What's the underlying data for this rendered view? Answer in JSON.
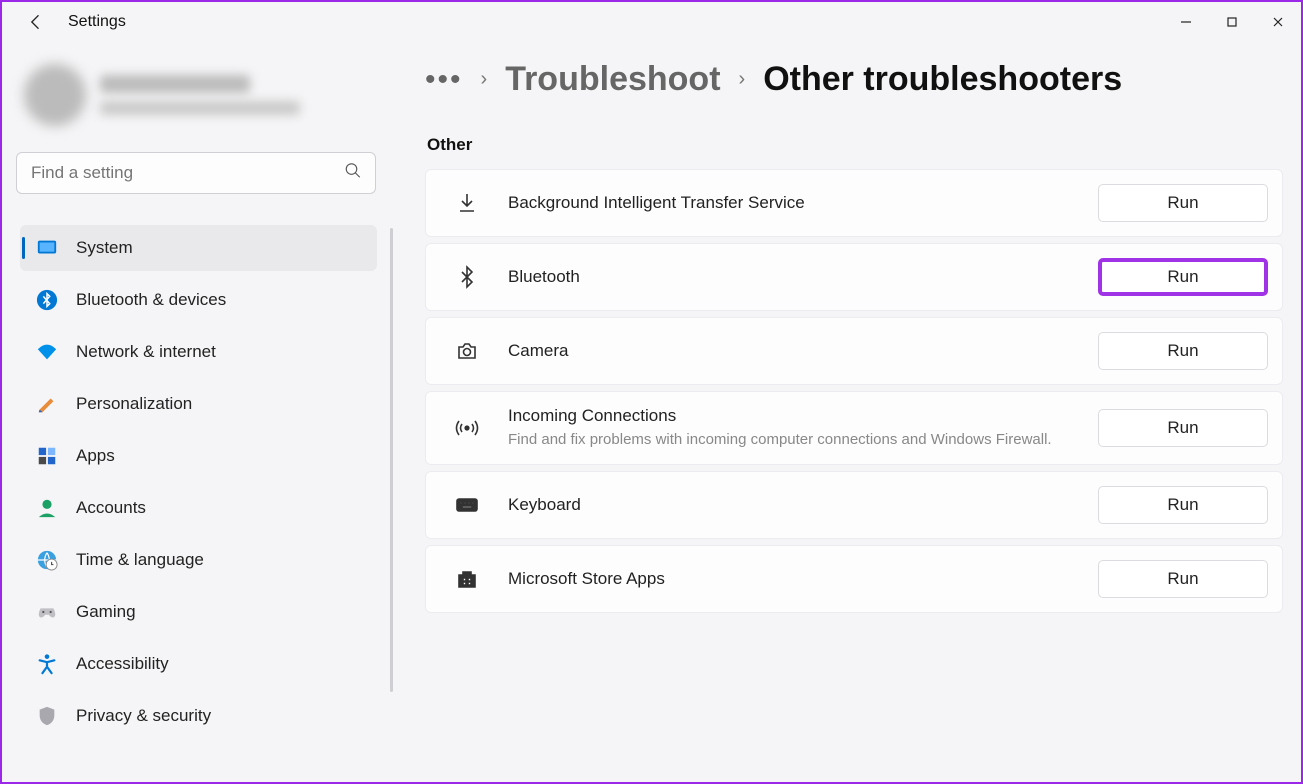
{
  "app": {
    "title": "Settings"
  },
  "search": {
    "placeholder": "Find a setting"
  },
  "sidebar": {
    "items": [
      {
        "label": "System"
      },
      {
        "label": "Bluetooth & devices"
      },
      {
        "label": "Network & internet"
      },
      {
        "label": "Personalization"
      },
      {
        "label": "Apps"
      },
      {
        "label": "Accounts"
      },
      {
        "label": "Time & language"
      },
      {
        "label": "Gaming"
      },
      {
        "label": "Accessibility"
      },
      {
        "label": "Privacy & security"
      }
    ]
  },
  "breadcrumb": {
    "parent": "Troubleshoot",
    "current": "Other troubleshooters"
  },
  "section": {
    "title": "Other"
  },
  "items": [
    {
      "title": "Background Intelligent Transfer Service",
      "run": "Run"
    },
    {
      "title": "Bluetooth",
      "run": "Run",
      "highlight": true
    },
    {
      "title": "Camera",
      "run": "Run"
    },
    {
      "title": "Incoming Connections",
      "sub": "Find and fix problems with incoming computer connections and Windows Firewall.",
      "run": "Run"
    },
    {
      "title": "Keyboard",
      "run": "Run"
    },
    {
      "title": "Microsoft Store Apps",
      "run": "Run"
    }
  ]
}
